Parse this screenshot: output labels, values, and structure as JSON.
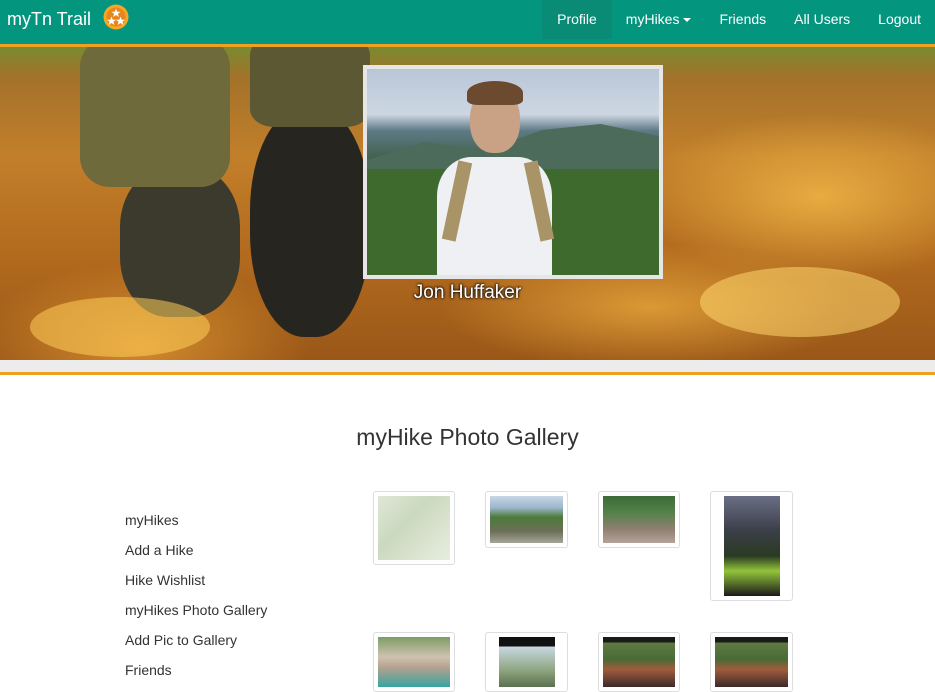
{
  "navbar": {
    "brand": "myTn Trail",
    "logo_icon": "tennessee-tristar-icon",
    "items": [
      {
        "label": "Profile",
        "active": true
      },
      {
        "label": "myHikes",
        "dropdown": true
      },
      {
        "label": "Friends"
      },
      {
        "label": "All Users"
      },
      {
        "label": "Logout"
      }
    ],
    "color": "#04957f",
    "accent": "#f0a020"
  },
  "profile": {
    "name": "Jon Huffaker"
  },
  "gallery": {
    "title": "myHike Photo Gallery"
  },
  "side_menu": {
    "items": [
      "myHikes",
      "Add a Hike",
      "Hike Wishlist",
      "myHikes Photo Gallery",
      "Add Pic to Gallery",
      "Friends"
    ]
  }
}
